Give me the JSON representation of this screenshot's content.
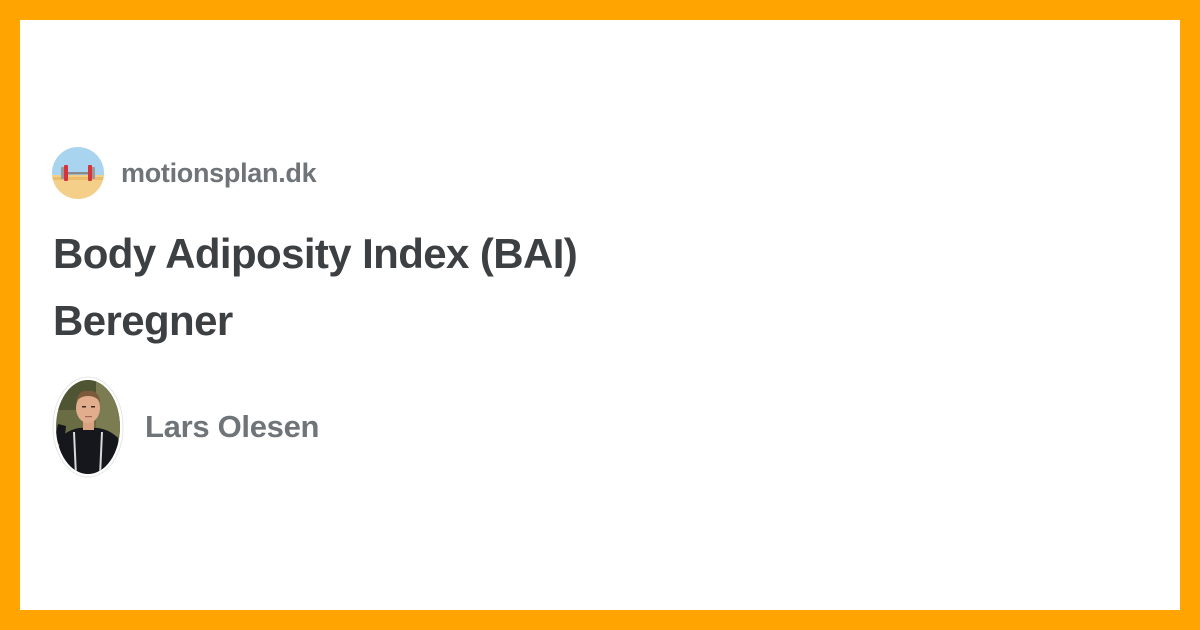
{
  "site": {
    "name": "motionsplan.dk",
    "logo_icon": "dumbbell-beach-icon"
  },
  "article": {
    "title_line1": "Body Adiposity Index (BAI)",
    "title_line2": "Beregner"
  },
  "author": {
    "name": "Lars Olesen",
    "avatar_icon": "author-photo"
  },
  "colors": {
    "frame": "#FFA400",
    "card": "#ffffff",
    "title": "#3c4043",
    "meta_text": "#6f7478"
  }
}
